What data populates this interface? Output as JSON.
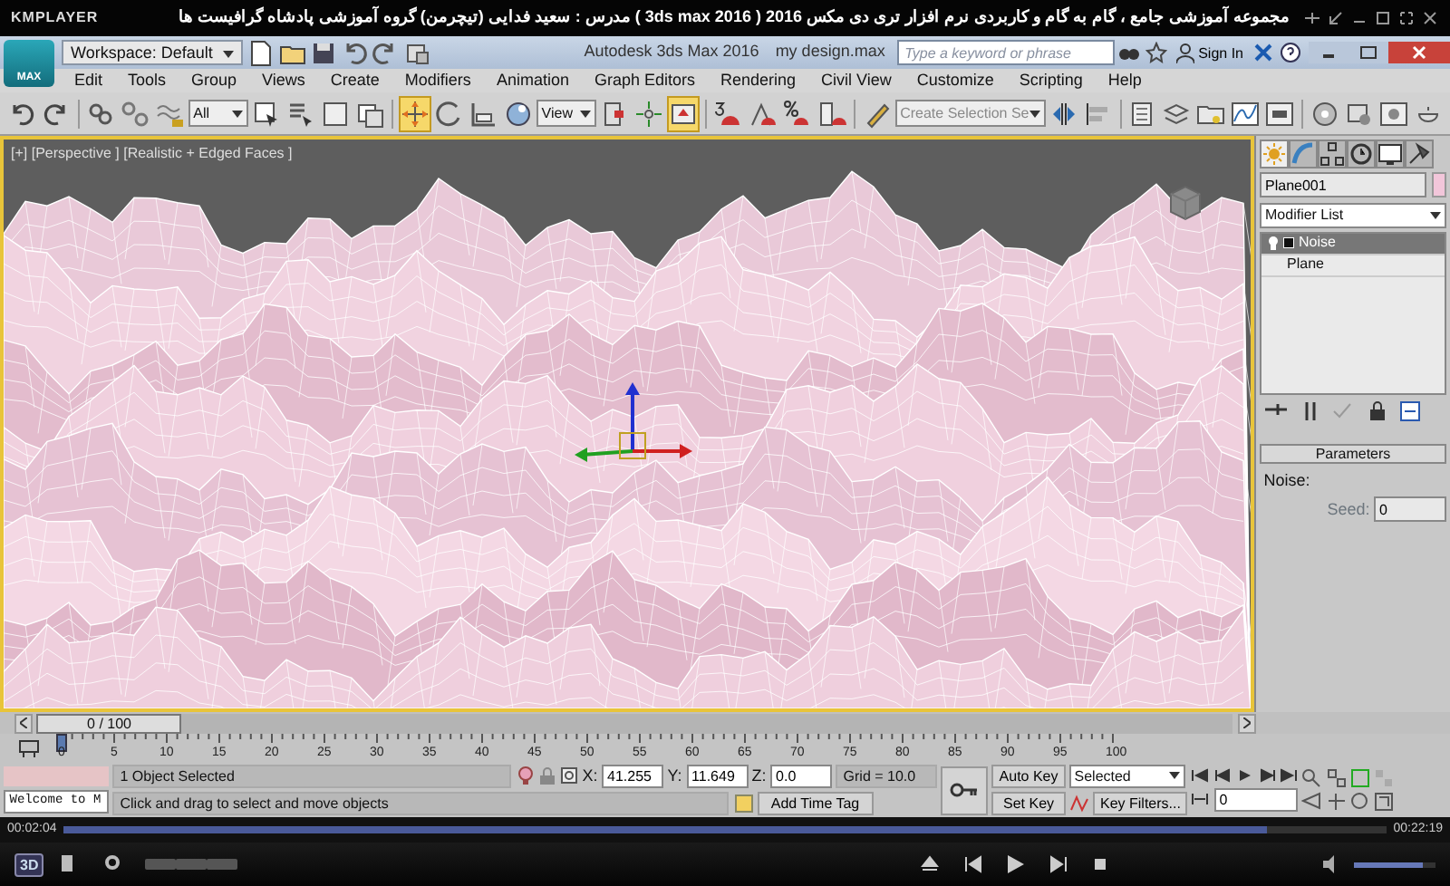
{
  "player": {
    "brand": "KMPLAYER",
    "title": "مجموعه آموزشی جامع ، گام به گام و کاربردی نرم افزار تری دی مکس 2016 ( 3ds max 2016 ) مدرس : سعید فدایی (تیچرمن) گروه آموزشی پادشاه گرافیست ها",
    "time_elapsed": "00:02:04",
    "time_total": "00:22:19",
    "mode_button": "3D",
    "progress": {
      "level": 0.91
    },
    "volume": {
      "level": 0.85
    }
  },
  "max_window": {
    "app_button": "MAX",
    "workspace": "Workspace: Default",
    "title": "Autodesk 3ds Max 2016",
    "file": "my design.max",
    "search": {
      "placeholder": "Type a keyword or phrase"
    },
    "sign_in": "Sign In"
  },
  "menu": [
    "Edit",
    "Tools",
    "Group",
    "Views",
    "Create",
    "Modifiers",
    "Animation",
    "Graph Editors",
    "Rendering",
    "Civil View",
    "Customize",
    "Scripting",
    "Help"
  ],
  "toolbar": [
    {
      "kind": "tool",
      "selected": false
    },
    {
      "kind": "tool",
      "selected": false
    },
    {
      "kind": "sep"
    },
    {
      "kind": "tool",
      "selected": false
    },
    {
      "kind": "tool",
      "selected": false
    },
    {
      "kind": "tool",
      "selected": false
    },
    {
      "kind": "dropdown",
      "value": "All"
    },
    {
      "kind": "tool",
      "selected": false
    },
    {
      "kind": "tool",
      "selected": false
    },
    {
      "kind": "tool",
      "selected": false
    },
    {
      "kind": "tool",
      "selected": false
    },
    {
      "kind": "sep"
    },
    {
      "kind": "tool",
      "selected": true
    },
    {
      "kind": "tool",
      "selected": false
    },
    {
      "kind": "tool",
      "selected": false
    },
    {
      "kind": "tool",
      "selected": false
    },
    {
      "kind": "dropdown",
      "value": "View"
    },
    {
      "kind": "tool",
      "selected": false
    },
    {
      "kind": "tool",
      "selected": false
    },
    {
      "kind": "tool",
      "selected": true
    },
    {
      "kind": "sep"
    },
    {
      "kind": "tool",
      "selected": false
    },
    {
      "kind": "tool",
      "selected": false
    },
    {
      "kind": "tool",
      "selected": false
    },
    {
      "kind": "tool",
      "selected": false
    },
    {
      "kind": "sep"
    },
    {
      "kind": "tool",
      "selected": false
    },
    {
      "kind": "dropdown",
      "placeholder": "Create Selection Se"
    },
    {
      "kind": "tool",
      "selected": false
    },
    {
      "kind": "tool",
      "selected": false
    },
    {
      "kind": "sep"
    },
    {
      "kind": "tool",
      "selected": false
    },
    {
      "kind": "tool",
      "selected": false
    },
    {
      "kind": "tool",
      "selected": false
    },
    {
      "kind": "tool",
      "selected": false
    },
    {
      "kind": "tool",
      "selected": false
    },
    {
      "kind": "sep"
    },
    {
      "kind": "tool",
      "selected": false
    },
    {
      "kind": "tool",
      "selected": false
    },
    {
      "kind": "tool",
      "selected": false
    },
    {
      "kind": "tool",
      "selected": false
    }
  ],
  "viewport": {
    "labels": [
      "[+]",
      "[Perspective ]",
      "[Realistic + Edged Faces ]"
    ],
    "active": true
  },
  "command_panel": {
    "tabs": [
      {
        "selected": true
      },
      {
        "selected": false
      },
      {
        "selected": false
      },
      {
        "selected": false
      },
      {
        "selected": false
      },
      {
        "selected": false
      }
    ],
    "object_name": "Plane001",
    "modifier_list": "Modifier List",
    "stack": [
      {
        "label": "Noise",
        "selected": true
      },
      {
        "label": "Plane",
        "selected": false
      }
    ],
    "rollout": {
      "title": "Parameters",
      "group": "Noise:",
      "seed_label": "Seed:",
      "seed_value": "0"
    }
  },
  "time_slider": {
    "label": "0 / 100",
    "level": 0
  },
  "track_labels": [
    "0",
    "5",
    "10",
    "15",
    "20",
    "25",
    "30",
    "35",
    "40",
    "45",
    "50",
    "55",
    "60",
    "65",
    "70",
    "75",
    "80",
    "85",
    "90",
    "95",
    "100"
  ],
  "status": {
    "listener": "Welcome to M",
    "selection": "1 Object Selected",
    "prompt": "Click and drag to select and move objects",
    "coordinates": [
      {
        "label": "X:",
        "value": "41.255"
      },
      {
        "label": "Y:",
        "value": "11.649"
      },
      {
        "label": "Z:",
        "value": "0.0"
      }
    ],
    "grid": "Grid = 10.0",
    "time_tag": "Add Time Tag",
    "auto_key": "Auto Key",
    "set_key": "Set Key",
    "key_mode": "Selected",
    "key_filters": "Key Filters...",
    "frame": "0"
  }
}
